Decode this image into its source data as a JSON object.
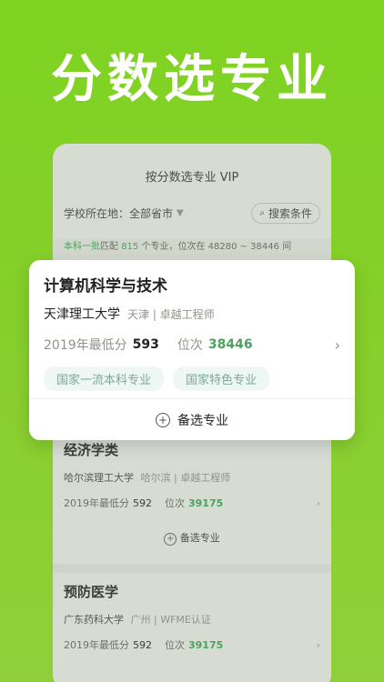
{
  "hero": {
    "title": "分数选专业"
  },
  "phone": {
    "header": "按分数选专业 VIP",
    "filter": {
      "label": "学校所在地：",
      "value": "全部省市",
      "search": "搜索条件"
    },
    "match": {
      "prefix": "本科一批",
      "text1": "匹配",
      "count": "815",
      "text2": " 个专业，位次在 48280 ~ 38446 间"
    }
  },
  "popup": {
    "major": "计算机科学与技术",
    "university": "天津理工大学",
    "meta": "天津 | 卓越工程师",
    "score_label": "2019年最低分",
    "score": "593",
    "rank_label": "位次",
    "rank": "38446",
    "tags": [
      "国家一流本科专业",
      "国家特色专业"
    ],
    "alt_label": "备选专业"
  },
  "list": [
    {
      "major": "经济学类",
      "university": "哈尔滨理工大学",
      "meta": "哈尔滨 | 卓越工程师",
      "score_label": "2019年最低分",
      "score": "592",
      "rank_label": "位次",
      "rank": "39175",
      "alt_label": "备选专业"
    },
    {
      "major": "预防医学",
      "university": "广东药科大学",
      "meta": "广州 | WFME认证",
      "score_label": "2019年最低分",
      "score": "592",
      "rank_label": "位次",
      "rank": "39175"
    }
  ]
}
